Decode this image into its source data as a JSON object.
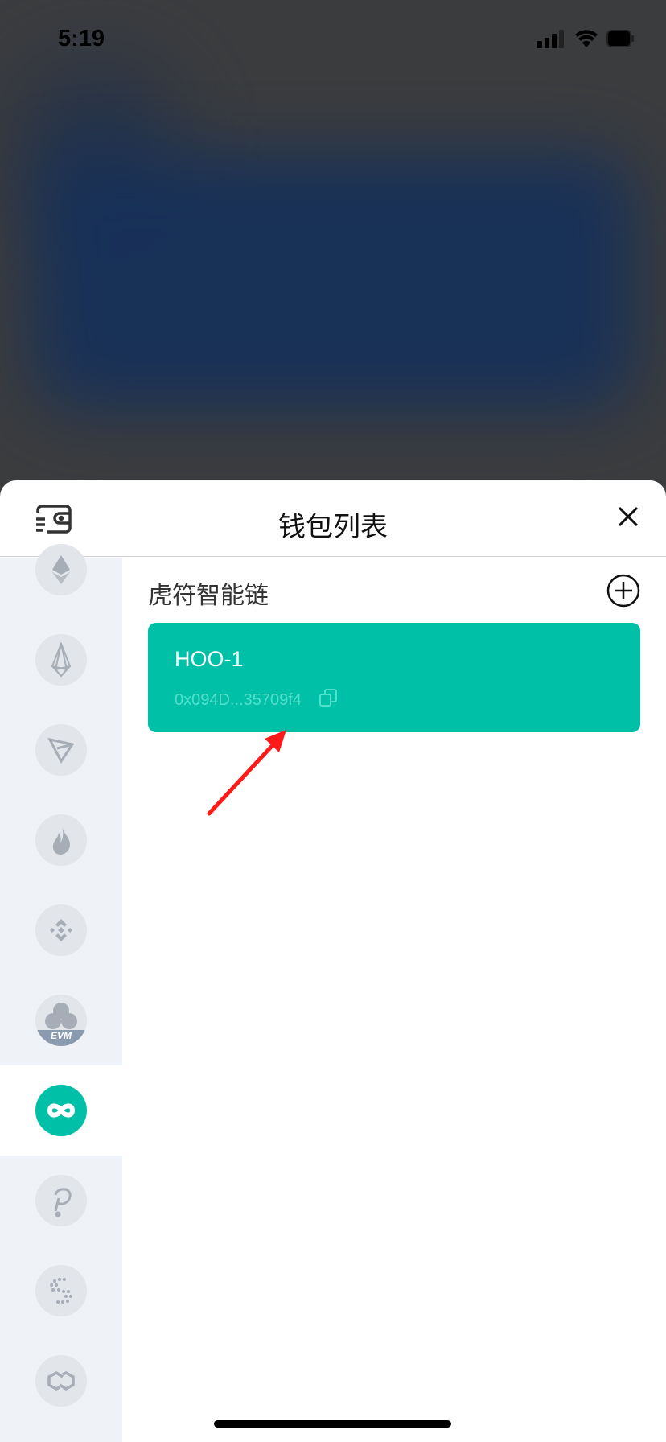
{
  "status_bar": {
    "time": "5:19"
  },
  "sheet": {
    "title": "钱包列表",
    "wallet_icon": "wallet-icon",
    "close_icon": "close-icon"
  },
  "sidebar": {
    "chains": [
      {
        "icon": "ethereum-icon",
        "selected": false
      },
      {
        "icon": "eos-icon",
        "selected": false
      },
      {
        "icon": "tron-icon",
        "selected": false
      },
      {
        "icon": "heco-flame-icon",
        "selected": false
      },
      {
        "icon": "binance-icon",
        "selected": false
      },
      {
        "icon": "evm-icon",
        "selected": false,
        "badge": "EVM"
      },
      {
        "icon": "hoo-chain-icon",
        "selected": true
      },
      {
        "icon": "polkadot-icon",
        "selected": false
      },
      {
        "icon": "iotex-icon",
        "selected": false
      },
      {
        "icon": "polygon-icon",
        "selected": false
      }
    ]
  },
  "main": {
    "section_title": "虎符智能链",
    "add_icon": "add-circle-icon",
    "wallets": [
      {
        "name": "HOO-1",
        "address": "0x094D...35709f4"
      }
    ]
  },
  "colors": {
    "accent": "#00c0a8",
    "sidebar_bg": "#eff2f6",
    "annotation_arrow": "#ff1a1a"
  }
}
